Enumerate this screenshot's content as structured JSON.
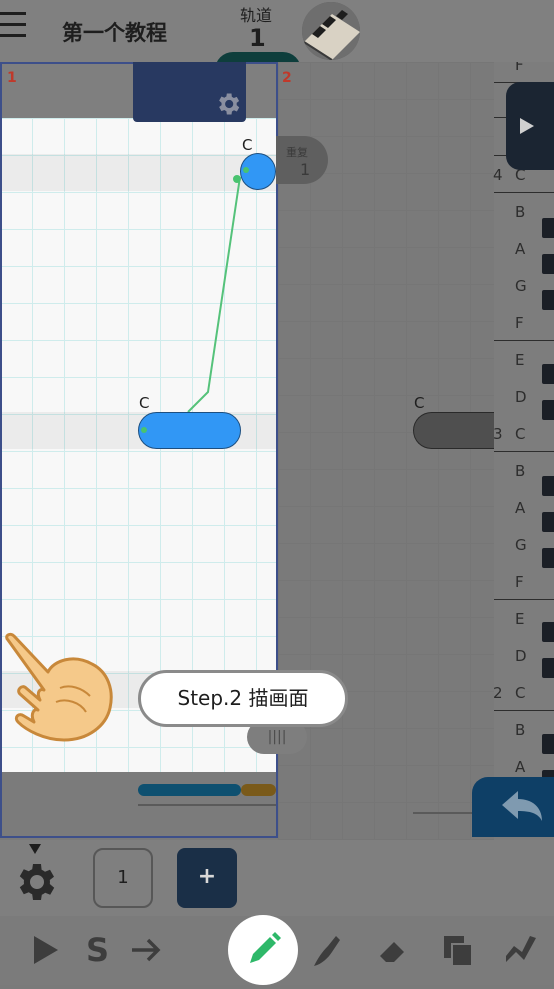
{
  "header": {
    "title": "第一个教程",
    "track_label": "轨道",
    "track_number": "1"
  },
  "panels": [
    {
      "label": "1"
    },
    {
      "label": "2"
    }
  ],
  "repeat_badge": {
    "label": "重复",
    "count": "1"
  },
  "notes": [
    {
      "label": "C"
    },
    {
      "label": "C"
    },
    {
      "label": "C"
    }
  ],
  "keyboard": {
    "keys": [
      "F",
      "C",
      "B",
      "A",
      "G",
      "F",
      "E",
      "D",
      "C",
      "B",
      "A",
      "G",
      "F",
      "E",
      "D",
      "C",
      "B",
      "A"
    ],
    "octaves": [
      "4",
      "3",
      "2"
    ]
  },
  "scroll_handle": "||||",
  "tooltip": "Step.2 描画面",
  "bottom": {
    "count": "1",
    "add_label": "+",
    "s_label": "S"
  },
  "colors": {
    "note_active": "#3197f5",
    "accent_green": "#2eb869",
    "settings_tab": "#283961",
    "undo": "#0e3f66"
  }
}
